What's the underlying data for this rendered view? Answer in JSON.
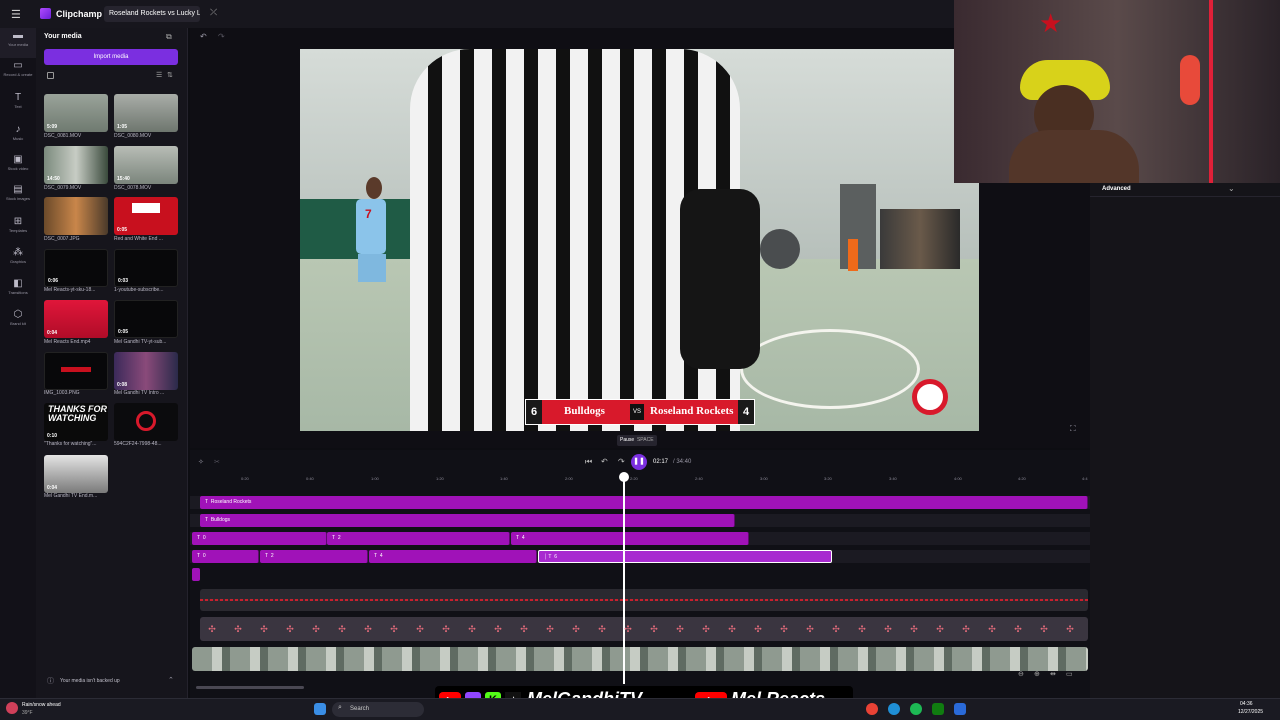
{
  "app": {
    "name": "Clipchamp",
    "project_tab": "Roseland Rockets vs Lucky L"
  },
  "rail": [
    {
      "label": "Your media",
      "icon": "folder-icon"
    },
    {
      "label": "Record & create",
      "icon": "camera-icon"
    },
    {
      "label": "Text",
      "icon": "text-icon"
    },
    {
      "label": "Music",
      "icon": "music-icon"
    },
    {
      "label": "Stock video",
      "icon": "stock-video-icon"
    },
    {
      "label": "Stock images",
      "icon": "stock-images-icon"
    },
    {
      "label": "Templates",
      "icon": "templates-icon"
    },
    {
      "label": "Graphics",
      "icon": "graphics-icon"
    },
    {
      "label": "Transitions",
      "icon": "transitions-icon"
    },
    {
      "label": "Brand kit",
      "icon": "brand-kit-icon"
    }
  ],
  "media_panel": {
    "title": "Your media",
    "import_label": "Import media",
    "backup_notice": "Your media isn't backed up",
    "items": [
      {
        "name": "DSC_0081.MOV",
        "duration": "5:09"
      },
      {
        "name": "DSC_0080.MOV",
        "duration": "1:05"
      },
      {
        "name": "DSC_0079.MOV",
        "duration": "14:50"
      },
      {
        "name": "DSC_0078.MOV",
        "duration": "15:40"
      },
      {
        "name": "DSC_0007.JPG",
        "duration": ""
      },
      {
        "name": "Red and White End ...",
        "duration": "0:05"
      },
      {
        "name": "Mel Reacts-yt-sku-18...",
        "duration": "0:06"
      },
      {
        "name": "1-youtube-subscribe...",
        "duration": "0:03"
      },
      {
        "name": "Mel Reacts End.mp4",
        "duration": "0:04"
      },
      {
        "name": "Mel Gandhi TV-yt-sub...",
        "duration": "0:05"
      },
      {
        "name": "IMG_1003.PNG",
        "duration": ""
      },
      {
        "name": "Mel Gandhi TV Intro ...",
        "duration": "0:08"
      },
      {
        "name": "\"Thanks for watching\"...",
        "duration": "0:10"
      },
      {
        "name": "594C2F24-7998-48...",
        "duration": ""
      },
      {
        "name": "Mel Gandhi TV End.m...",
        "duration": "0:04"
      }
    ],
    "thanks_text": "THANKS FOR WATCHING"
  },
  "preview": {
    "scoreboard": {
      "home_score": "6",
      "home_team": "Bulldogs",
      "vs": "VS",
      "away_team": "Roseland Rockets",
      "away_score": "4"
    },
    "jersey_number": "7"
  },
  "playback": {
    "tooltip_label": "Pause",
    "tooltip_key": "SPACE",
    "current_time": "02:17",
    "total_time": "/ 34:40",
    "progress": 0.066
  },
  "ruler": [
    "0:20",
    "0:40",
    "1:00",
    "1:20",
    "1:40",
    "2:00",
    "2:20",
    "2:40",
    "3:00",
    "3:20",
    "3:40",
    "4:00",
    "4:20",
    "4:4"
  ],
  "tracks": {
    "row1": [
      "Roseland Rockets"
    ],
    "row2": [
      "Bulldogs"
    ],
    "row3": [
      "0",
      "2",
      "4"
    ],
    "row4": [
      "0",
      "2",
      "4",
      "6"
    ]
  },
  "right_panel": {
    "advanced_label": "Advanced"
  },
  "overlay": {
    "brand1": "MelGandhiTV",
    "brand2": "Mel Reacts"
  },
  "taskbar": {
    "weather": "Rain/snow ahead",
    "temp": "39°F",
    "search": "Search",
    "time": "04:36",
    "date": "12/27/2025"
  },
  "colors": {
    "accent": "#a012b8",
    "button": "#7b2fe0",
    "scoreboard_red": "#d8192b"
  }
}
